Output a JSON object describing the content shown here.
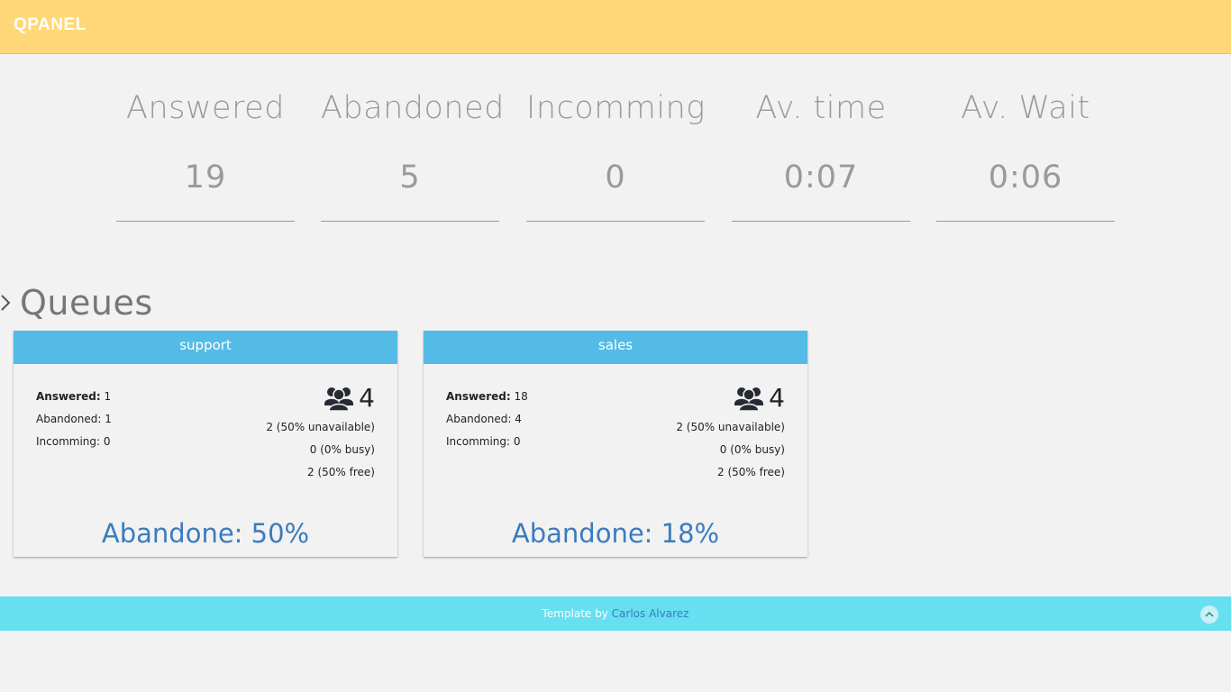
{
  "header": {
    "brand": "QPANEL"
  },
  "stats": [
    {
      "label": "Answered",
      "value": "19"
    },
    {
      "label": "Abandoned",
      "value": "5"
    },
    {
      "label": "Incomming",
      "value": "0"
    },
    {
      "label": "Av. time",
      "value": "0:07"
    },
    {
      "label": "Av. Wait",
      "value": "0:06"
    }
  ],
  "section": {
    "title": "Queues",
    "icon": "chevron-right-icon"
  },
  "queues": [
    {
      "name": "support",
      "answered_label": "Answered:",
      "answered": "1",
      "abandoned_text": "Abandoned: 1",
      "incomming_text": "Incomming: 0",
      "agents": "4",
      "unavailable": "2 (50% unavailable)",
      "busy": "0 (0% busy)",
      "free": "2 (50% free)",
      "abandone": "Abandone: 50%"
    },
    {
      "name": "sales",
      "answered_label": "Answered:",
      "answered": "18",
      "abandoned_text": "Abandoned: 4",
      "incomming_text": "Incomming: 0",
      "agents": "4",
      "unavailable": "2 (50% unavailable)",
      "busy": "0 (0% busy)",
      "free": "2 (50% free)",
      "abandone": "Abandone: 18%"
    }
  ],
  "footer": {
    "prefix": "Template by",
    "author": "Carlos Alvarez",
    "to_top_icon": "chevron-up-icon"
  },
  "colors": {
    "header_bg": "#ffd777",
    "card_head_bg": "#54bbe6",
    "footer_bg": "#66dff0",
    "accent": "#3a7bbf"
  }
}
